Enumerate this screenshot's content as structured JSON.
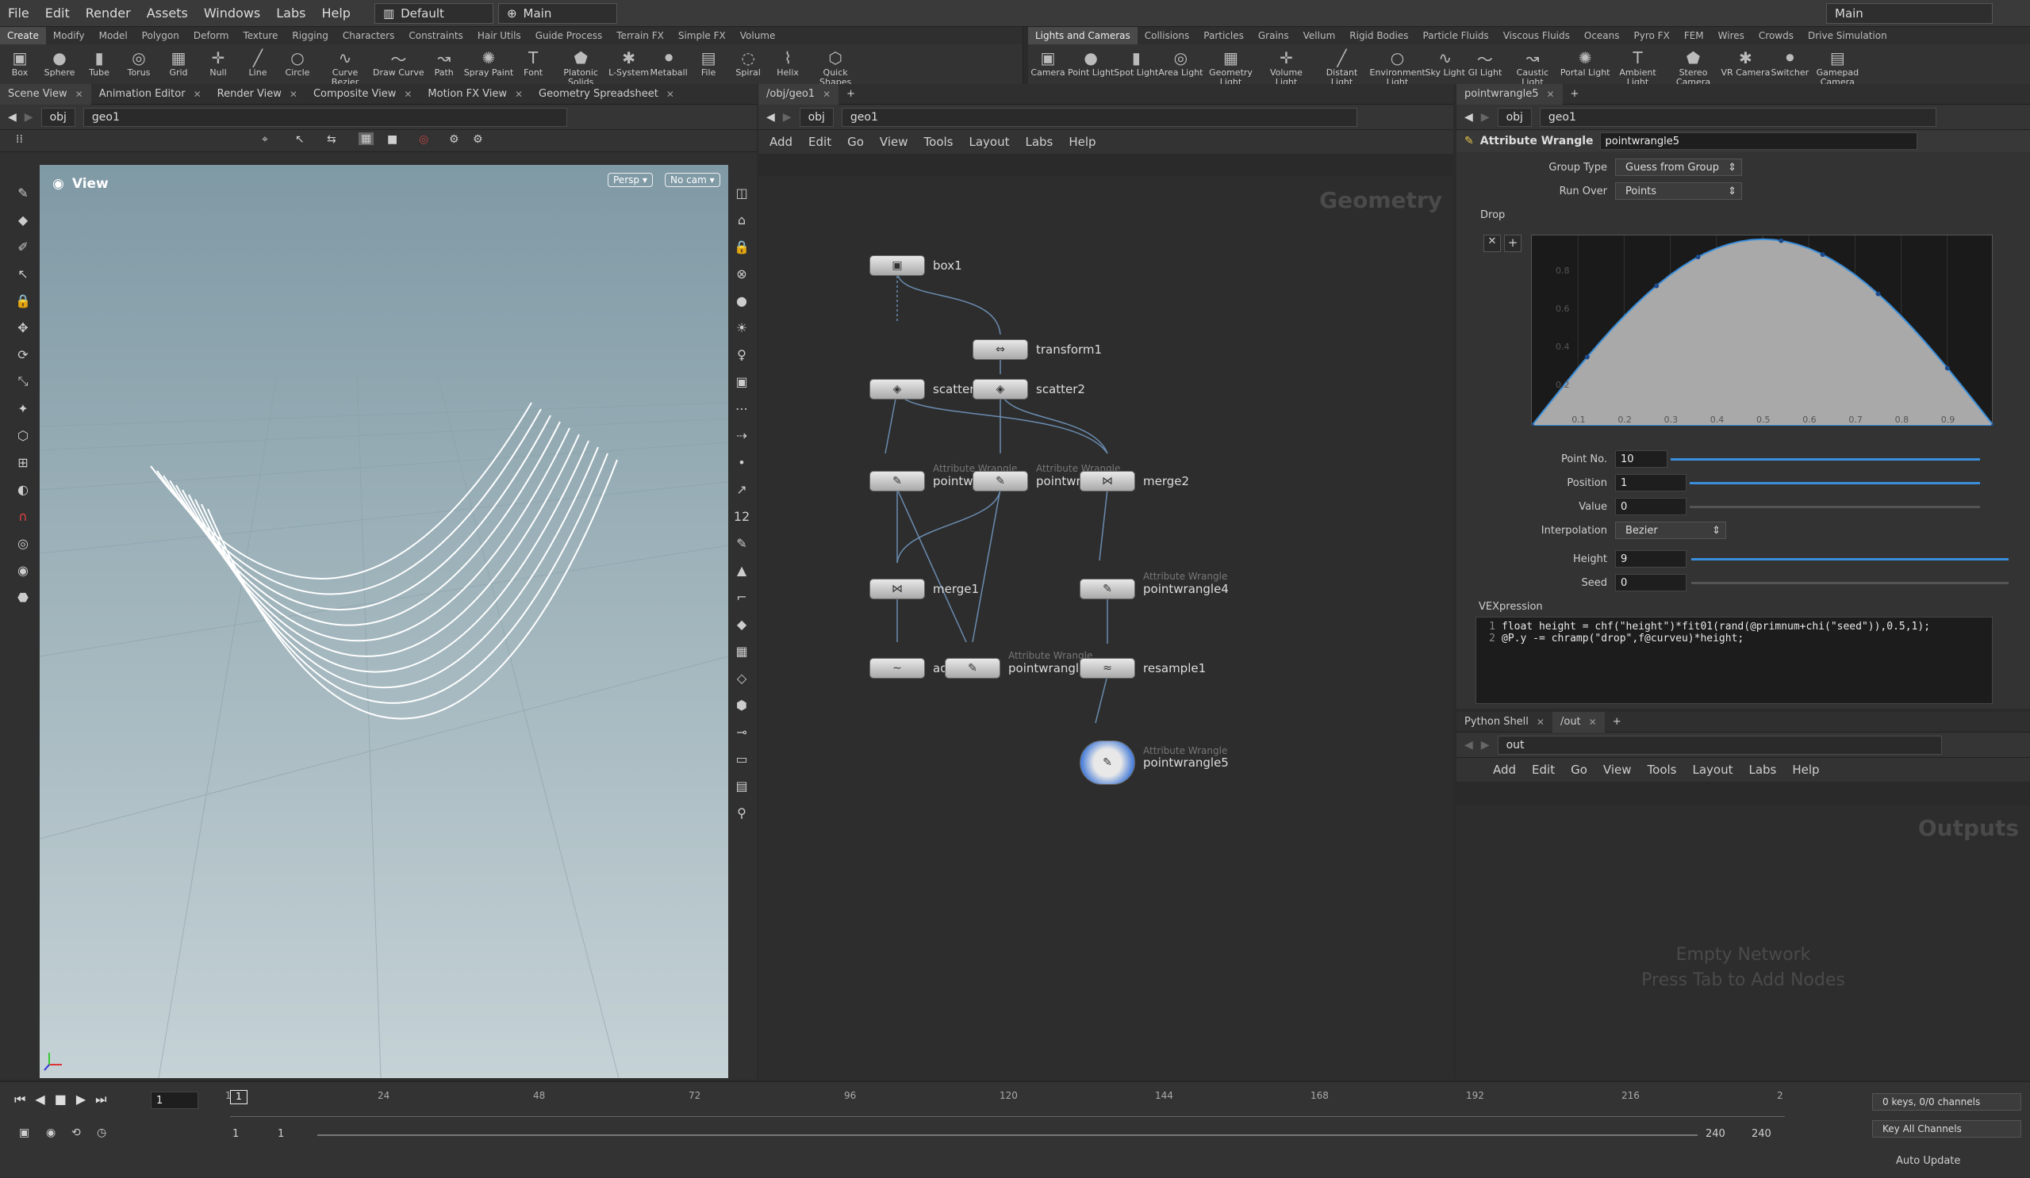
{
  "menubar": {
    "items": [
      "File",
      "Edit",
      "Render",
      "Assets",
      "Windows",
      "Labs",
      "Help"
    ],
    "desktop": "Default",
    "context": "Main",
    "right_context": "Main"
  },
  "shelf_left": {
    "tabs": [
      "Create",
      "Modify",
      "Model",
      "Polygon",
      "Deform",
      "Texture",
      "Rigging",
      "Characters",
      "Constraints",
      "Hair Utils",
      "Guide Process",
      "Terrain FX",
      "Simple FX",
      "Volume"
    ],
    "active": "Create",
    "tools": [
      "Box",
      "Sphere",
      "Tube",
      "Torus",
      "Grid",
      "Null",
      "Line",
      "Circle",
      "Curve Bezier",
      "Draw Curve",
      "Path",
      "Spray Paint",
      "Font",
      "Platonic Solids",
      "L-System",
      "Metaball",
      "File",
      "Spiral",
      "Helix",
      "Quick Shapes"
    ]
  },
  "shelf_right": {
    "tabs": [
      "Lights and Cameras",
      "Collisions",
      "Particles",
      "Grains",
      "Vellum",
      "Rigid Bodies",
      "Particle Fluids",
      "Viscous Fluids",
      "Oceans",
      "Pyro FX",
      "FEM",
      "Wires",
      "Crowds",
      "Drive Simulation"
    ],
    "active": "Lights and Cameras",
    "tools": [
      "Camera",
      "Point Light",
      "Spot Light",
      "Area Light",
      "Geometry Light",
      "Volume Light",
      "Distant Light",
      "Environment Light",
      "Sky Light",
      "GI Light",
      "Caustic Light",
      "Portal Light",
      "Ambient Light",
      "Stereo Camera",
      "VR Camera",
      "Switcher",
      "Gamepad Camera"
    ]
  },
  "scene_view": {
    "tabs": [
      "Scene View",
      "Animation Editor",
      "Render View",
      "Composite View",
      "Motion FX View",
      "Geometry Spreadsheet"
    ],
    "path": [
      "obj",
      "geo1"
    ],
    "view_label": "View",
    "persp": "Persp",
    "cam": "No cam"
  },
  "network": {
    "tab": "/obj/geo1",
    "path": [
      "obj",
      "geo1"
    ],
    "menu": [
      "Add",
      "Edit",
      "Go",
      "View",
      "Tools",
      "Layout",
      "Labs",
      "Help"
    ],
    "watermark": "Geometry",
    "nodes": [
      {
        "id": "box1",
        "label": "box1",
        "type": ""
      },
      {
        "id": "transform1",
        "label": "transform1",
        "type": ""
      },
      {
        "id": "scatter1",
        "label": "scatter1",
        "type": ""
      },
      {
        "id": "scatter2",
        "label": "scatter2",
        "type": ""
      },
      {
        "id": "pointwrangle1",
        "label": "pointwrangle1",
        "type": "Attribute Wrangle"
      },
      {
        "id": "pointwrangle2",
        "label": "pointwrangle2",
        "type": "Attribute Wrangle"
      },
      {
        "id": "merge2",
        "label": "merge2",
        "type": ""
      },
      {
        "id": "merge1",
        "label": "merge1",
        "type": ""
      },
      {
        "id": "pointwrangle4",
        "label": "pointwrangle4",
        "type": "Attribute Wrangle"
      },
      {
        "id": "add1",
        "label": "add1",
        "type": ""
      },
      {
        "id": "pointwrangle3",
        "label": "pointwrangle3",
        "type": "Attribute Wrangle"
      },
      {
        "id": "resample1",
        "label": "resample1",
        "type": ""
      },
      {
        "id": "pointwrangle5",
        "label": "pointwrangle5",
        "type": "Attribute Wrangle"
      }
    ]
  },
  "params": {
    "tab": "pointwrangle5",
    "path": [
      "obj",
      "geo1"
    ],
    "node_type": "Attribute Wrangle",
    "node_name": "pointwrangle5",
    "group_type_label": "Group Type",
    "group_type": "Guess from Group",
    "run_over_label": "Run Over",
    "run_over": "Points",
    "ramp_label": "Drop",
    "point_no_label": "Point No.",
    "point_no": "10",
    "position_label": "Position",
    "position": "1",
    "value_label": "Value",
    "value": "0",
    "interp_label": "Interpolation",
    "interp": "Bezier",
    "height_label": "Height",
    "height": "9",
    "seed_label": "Seed",
    "seed": "0",
    "vex_label": "VEXpression",
    "ramp_ticks": [
      "0.1",
      "0.2",
      "0.3",
      "0.4",
      "0.5",
      "0.6",
      "0.7",
      "0.8",
      "0.9"
    ],
    "ramp_y_ticks": [
      "0.8",
      "0.6",
      "0.4",
      "0.2"
    ],
    "code": [
      {
        "n": "1",
        "text": "float height = chf(\"height\")*fit01(rand(@primnum+chi(\"seed\")),0.5,1);"
      },
      {
        "n": "2",
        "text": "@P.y -= chramp(\"drop\",f@curveu)*height;"
      }
    ]
  },
  "outputs": {
    "tabs": [
      "Python Shell",
      "/out"
    ],
    "path": "out",
    "menu": [
      "Add",
      "Edit",
      "Go",
      "View",
      "Tools",
      "Layout",
      "Labs",
      "Help"
    ],
    "watermark": "Outputs",
    "empty1": "Empty Network",
    "empty2": "Press Tab to Add Nodes"
  },
  "timeline": {
    "frame": "1",
    "ticks": [
      "1",
      "24",
      "48",
      "72",
      "96",
      "120",
      "144",
      "168",
      "192",
      "216",
      "2"
    ],
    "start": "1",
    "start2": "1",
    "end": "240",
    "end2": "240",
    "keys": "0 keys, 0/0 channels",
    "key_all": "Key All Channels",
    "auto_update": "Auto Update"
  },
  "colors": {
    "accent": "#3a8fdc",
    "bg": "#2b2b2b",
    "viewport_top": "#7f99a5",
    "viewport_bottom": "#c5d2d6"
  }
}
